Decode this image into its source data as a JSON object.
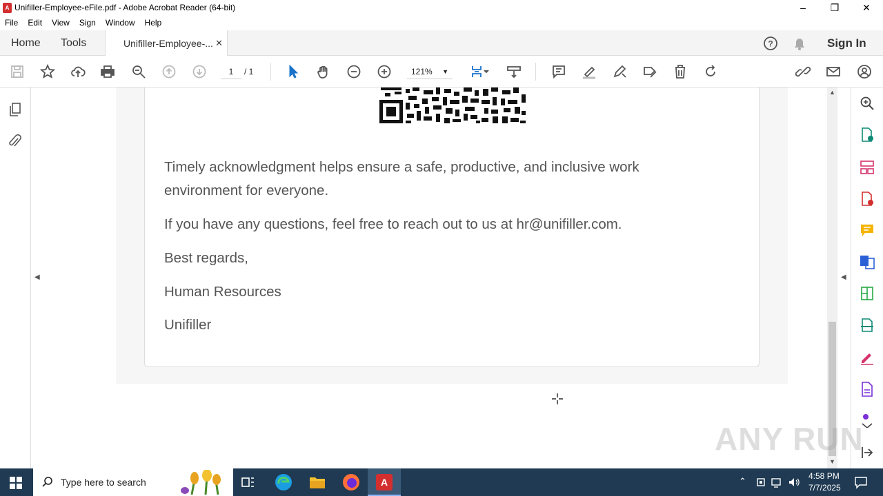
{
  "window": {
    "title": "Unifiller-Employee-eFile.pdf - Adobe Acrobat Reader (64-bit)"
  },
  "menu": [
    "File",
    "Edit",
    "View",
    "Sign",
    "Window",
    "Help"
  ],
  "tabs": {
    "home": "Home",
    "tools": "Tools",
    "document": "Unifiller-Employee-...",
    "sign_in": "Sign In"
  },
  "toolbar": {
    "page_current": "1",
    "page_total": "/ 1",
    "zoom": "121%"
  },
  "document": {
    "paragraph1_line1": "Timely acknowledgment helps ensure a safe, productive, and inclusive work",
    "paragraph1_line2": "environment for everyone.",
    "paragraph2": "If you have any questions, feel free to reach out to us at hr@unifiller.com.",
    "closing": "Best regards,",
    "department": "Human Resources",
    "company": "Unifiller"
  },
  "taskbar": {
    "search_placeholder": "Type here to search",
    "time": "4:58 PM",
    "date": "7/7/2025"
  },
  "watermark": "ANY RUN",
  "icons": {
    "app": "acrobat-pdf-icon",
    "accent": "#d32f2f"
  }
}
